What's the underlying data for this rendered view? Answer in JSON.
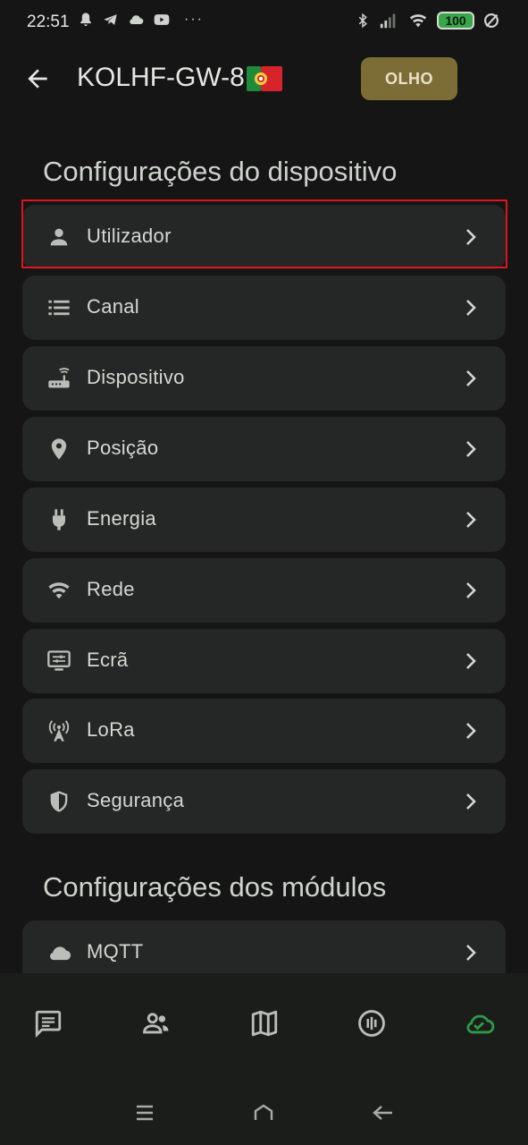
{
  "status_bar": {
    "time": "22:51",
    "overflow": "···",
    "battery": "100",
    "accent_battery": "#3aa64a"
  },
  "header": {
    "title": "KOLHF-GW-8",
    "flag": "portugal-flag",
    "action_label": "OLHO",
    "action_color": "#7c6d36"
  },
  "device_settings": {
    "title": "Configurações do dispositivo",
    "items": [
      {
        "label": "Utilizador",
        "icon": "person-icon"
      },
      {
        "label": "Canal",
        "icon": "list-icon"
      },
      {
        "label": "Dispositivo",
        "icon": "router-icon"
      },
      {
        "label": "Posição",
        "icon": "location-pin-icon"
      },
      {
        "label": "Energia",
        "icon": "power-plug-icon"
      },
      {
        "label": "Rede",
        "icon": "wifi-icon"
      },
      {
        "label": "Ecrã",
        "icon": "display-settings-icon"
      },
      {
        "label": "LoRa",
        "icon": "cell-tower-icon"
      },
      {
        "label": "Segurança",
        "icon": "shield-icon"
      }
    ]
  },
  "module_settings": {
    "title": "Configurações dos módulos",
    "items": [
      {
        "label": "MQTT",
        "icon": "cloud-icon"
      }
    ]
  },
  "bottom_nav": {
    "items": [
      {
        "icon": "chat-icon"
      },
      {
        "icon": "people-icon"
      },
      {
        "icon": "map-icon"
      },
      {
        "icon": "nfc-icon"
      },
      {
        "icon": "cloud-check-icon",
        "active": true
      }
    ],
    "active_color": "#2e9a45"
  },
  "selection_color": "#e2141b"
}
